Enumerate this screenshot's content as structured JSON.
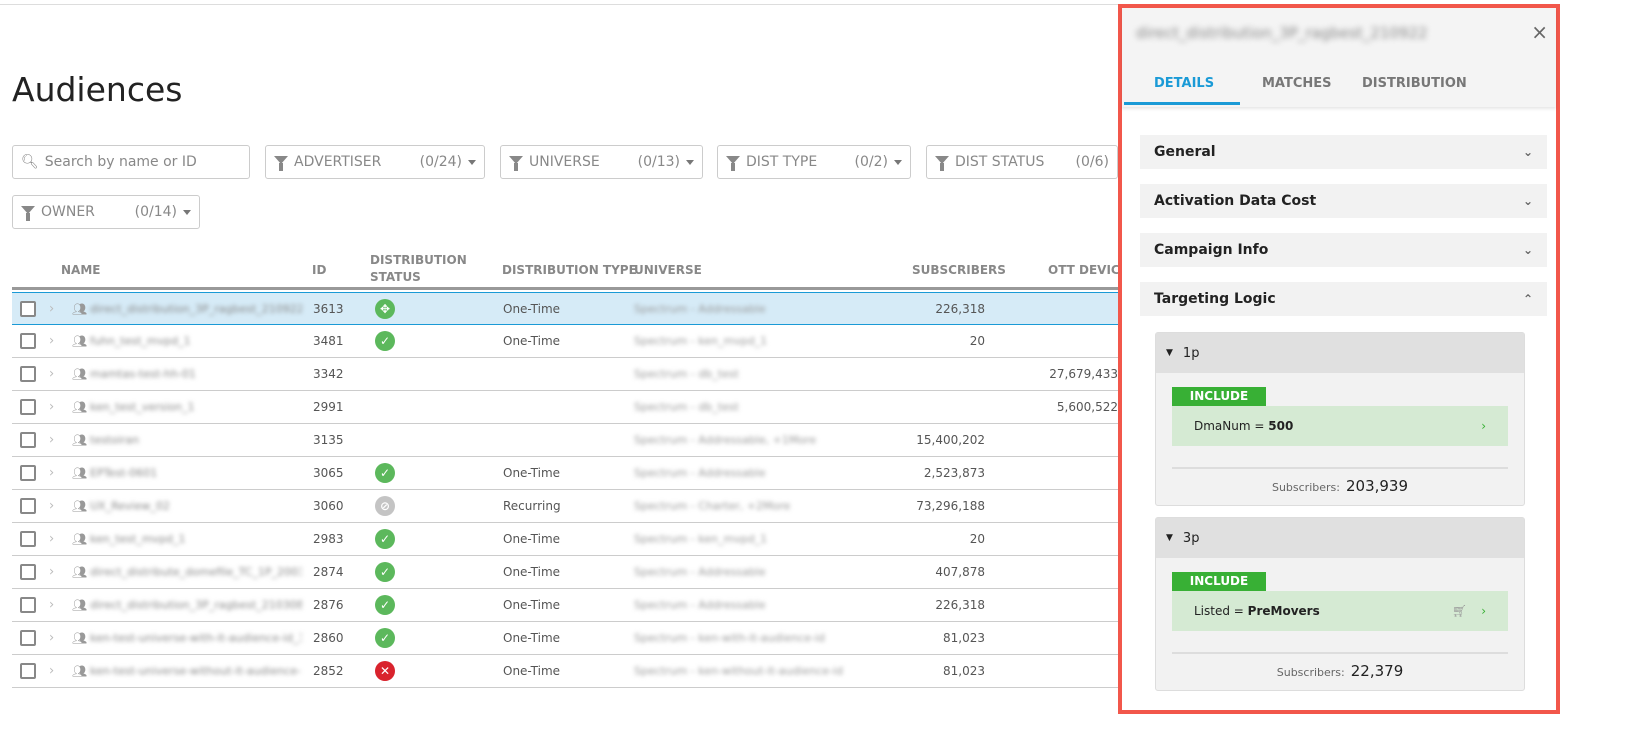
{
  "page": {
    "title": "Audiences"
  },
  "search": {
    "placeholder": "Search by name or ID"
  },
  "filters": [
    {
      "label": "ADVERTISER",
      "count": "(0/24)"
    },
    {
      "label": "UNIVERSE",
      "count": "(0/13)"
    },
    {
      "label": "DIST TYPE",
      "count": "(0/2)"
    },
    {
      "label": "DIST STATUS",
      "count": "(0/6)"
    },
    {
      "label": "OWNER",
      "count": "(0/14)"
    }
  ],
  "table": {
    "headers": {
      "name": "NAME",
      "id": "ID",
      "status": "DISTRIBUTION STATUS",
      "type": "DISTRIBUTION TYPE",
      "universe": "UNIVERSE",
      "subscribers": "SUBSCRIBERS",
      "ott": "OTT DEVICE"
    },
    "rows": [
      {
        "name": "direct_distribution_3P_ragbest_210922",
        "id": "3613",
        "status": "distributing",
        "type": "One-Time",
        "universe": "Spectrum - Addressable",
        "subscribers": "226,318",
        "ott": ""
      },
      {
        "name": "fuhn_test_mvpd_1",
        "id": "3481",
        "status": "success",
        "type": "One-Time",
        "universe": "Spectrum - ken_mvpd_1",
        "subscribers": "20",
        "ott": ""
      },
      {
        "name": "mamtas-test-hh-01",
        "id": "3342",
        "status": "",
        "type": "",
        "universe": "Spectrum - db_test",
        "subscribers": "",
        "ott": "27,679,433"
      },
      {
        "name": "ken_test_version_1",
        "id": "2991",
        "status": "",
        "type": "",
        "universe": "Spectrum - db_test",
        "subscribers": "",
        "ott": "5,600,522"
      },
      {
        "name": "testoiran",
        "id": "3135",
        "status": "",
        "type": "",
        "universe": "Spectrum - Addressable, +1More",
        "subscribers": "15,400,202",
        "ott": ""
      },
      {
        "name": "EPTest-0601",
        "id": "3065",
        "status": "success",
        "type": "One-Time",
        "universe": "Spectrum - Addressable",
        "subscribers": "2,523,873",
        "ott": ""
      },
      {
        "name": "UX_Review_02",
        "id": "3060",
        "status": "disabled",
        "type": "Recurring",
        "universe": "Spectrum - Charter, +2More",
        "subscribers": "73,296,188",
        "ott": ""
      },
      {
        "name": "ken_test_mvpd_1",
        "id": "2983",
        "status": "success",
        "type": "One-Time",
        "universe": "Spectrum - ken_mvpd_1",
        "subscribers": "20",
        "ott": ""
      },
      {
        "name": "direct_distribute_domefile_TC_1P_200308",
        "id": "2874",
        "status": "success",
        "type": "One-Time",
        "universe": "Spectrum - Addressable",
        "subscribers": "407,878",
        "ott": ""
      },
      {
        "name": "direct_distribution_3P_ragbest_210308",
        "id": "2876",
        "status": "success",
        "type": "One-Time",
        "universe": "Spectrum - Addressable",
        "subscribers": "226,318",
        "ott": ""
      },
      {
        "name": "ken-test-universe-with-it-audience-id_3",
        "id": "2860",
        "status": "success",
        "type": "One-Time",
        "universe": "Spectrum - ken-with-it-audience-id",
        "subscribers": "81,023",
        "ott": ""
      },
      {
        "name": "ken-test-universe-without-it-audience-id",
        "id": "2852",
        "status": "error",
        "type": "One-Time",
        "universe": "Spectrum - ken-without-it-audience-id",
        "subscribers": "81,023",
        "ott": ""
      }
    ]
  },
  "panel": {
    "title": "direct_distribution_3P_ragbest_210922",
    "close": "×",
    "tabs": [
      "DETAILS",
      "MATCHES",
      "DISTRIBUTION"
    ],
    "sections": [
      "General",
      "Activation Data Cost",
      "Campaign Info",
      "Targeting Logic"
    ],
    "groups": [
      {
        "label": "1p",
        "include": "INCLUDE",
        "rule_key": "DmaNum = ",
        "rule_val": "500",
        "subs_label": "Subscribers:",
        "subs": "203,939",
        "cart": false
      },
      {
        "label": "3p",
        "include": "INCLUDE",
        "rule_key": "Listed = ",
        "rule_val": "PreMovers",
        "subs_label": "Subscribers:",
        "subs": "22,379",
        "cart": true
      }
    ]
  },
  "colors": {
    "accent": "#1a9ad6",
    "success": "#5cb85c",
    "error": "#d9232d",
    "include": "#38b035",
    "highlight": "#f2574b"
  }
}
